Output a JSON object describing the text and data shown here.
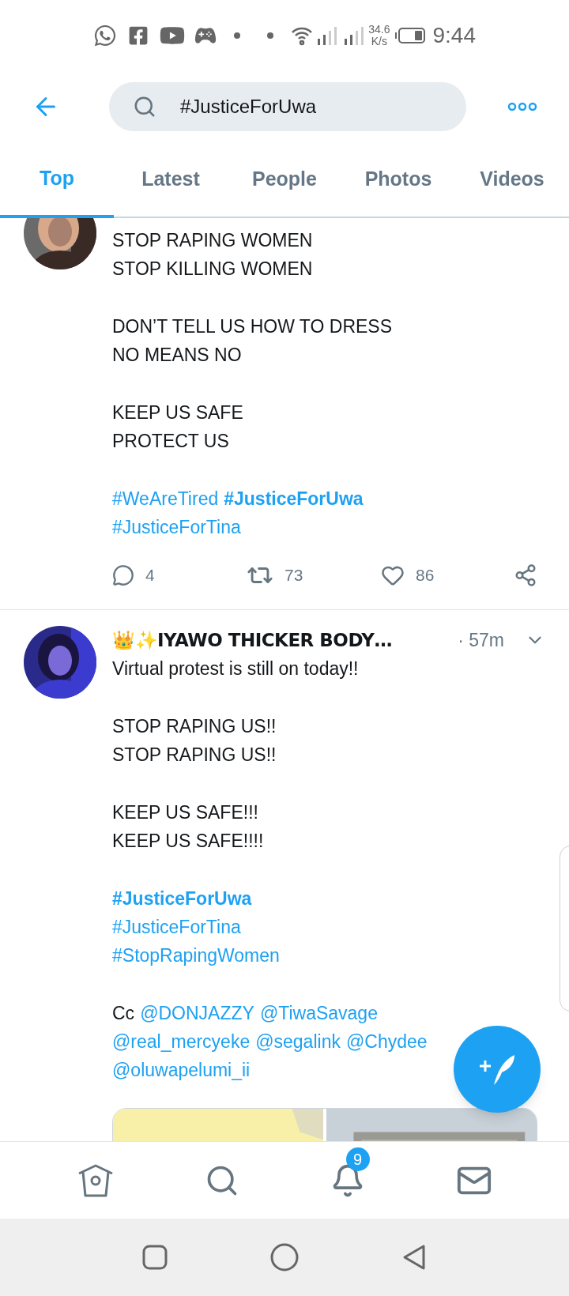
{
  "status_bar": {
    "speed": "34.6",
    "speed_unit": "K/s",
    "time": "9:44"
  },
  "search": {
    "value": "#JusticeForUwa"
  },
  "tabs": [
    {
      "label": "Top",
      "selected": true
    },
    {
      "label": "Latest",
      "selected": false
    },
    {
      "label": "People",
      "selected": false
    },
    {
      "label": "Photos",
      "selected": false
    },
    {
      "label": "Videos",
      "selected": false
    }
  ],
  "tweets": [
    {
      "avatar": {
        "kind": "picture"
      },
      "body": [
        [
          [
            {
              "kind": "text",
              "text": "STOP RAPING WOMEN"
            }
          ],
          [
            {
              "kind": "text",
              "text": "STOP KILLING WOMEN"
            }
          ]
        ],
        [
          [
            {
              "kind": "text",
              "text": "DON’T TELL US HOW TO DRESS"
            }
          ],
          [
            {
              "kind": "text",
              "text": "NO MEANS NO"
            }
          ]
        ],
        [
          [
            {
              "kind": "text",
              "text": "KEEP US SAFE"
            }
          ],
          [
            {
              "kind": "text",
              "text": "PROTECT US"
            }
          ]
        ],
        [
          [
            {
              "kind": "hashtag",
              "text": "#WeAreTired",
              "bold": false
            },
            {
              "kind": "hashtag",
              "text": "#JusticeForUwa",
              "bold": true
            }
          ],
          [
            {
              "kind": "hashtag",
              "text": "#JusticeForTina",
              "bold": false
            }
          ]
        ]
      ],
      "actions": {
        "replies": "4",
        "retweets": "73",
        "likes": "86"
      }
    },
    {
      "avatar": {
        "kind": "picture"
      },
      "header": {
        "name": "👑✨IYAWO THICKER BODY…",
        "time": "· 57m"
      },
      "body": [
        [
          [
            {
              "kind": "text",
              "text": "Virtual protest is still on today!!"
            }
          ]
        ],
        [
          [
            {
              "kind": "text",
              "text": "STOP RAPING US!!"
            }
          ],
          [
            {
              "kind": "text",
              "text": "STOP RAPING US!!"
            }
          ]
        ],
        [
          [
            {
              "kind": "text",
              "text": "KEEP US SAFE!!!"
            }
          ],
          [
            {
              "kind": "text",
              "text": "KEEP US SAFE!!!!"
            }
          ]
        ],
        [
          [
            {
              "kind": "hashtag",
              "text": "#JusticeForUwa",
              "bold": true
            }
          ],
          [
            {
              "kind": "hashtag",
              "text": "#JusticeForTina",
              "bold": false
            }
          ],
          [
            {
              "kind": "hashtag",
              "text": "#StopRapingWomen",
              "bold": false
            }
          ]
        ],
        [
          [
            {
              "kind": "text",
              "text": "Cc"
            },
            {
              "kind": "mention",
              "text": "@DONJAZZY"
            },
            {
              "kind": "mention",
              "text": "@TiwaSavage"
            }
          ],
          [
            {
              "kind": "mention",
              "text": "@real_mercyeke"
            },
            {
              "kind": "mention",
              "text": "@segalink"
            },
            {
              "kind": "mention",
              "text": "@Chydee"
            }
          ],
          [
            {
              "kind": "mention",
              "text": "@oluwapelumi_ii"
            }
          ]
        ]
      ],
      "media": [
        {
          "kind": "picture"
        },
        {
          "kind": "picture"
        }
      ]
    }
  ],
  "bottom_nav": {
    "notifications_badge": "9"
  }
}
